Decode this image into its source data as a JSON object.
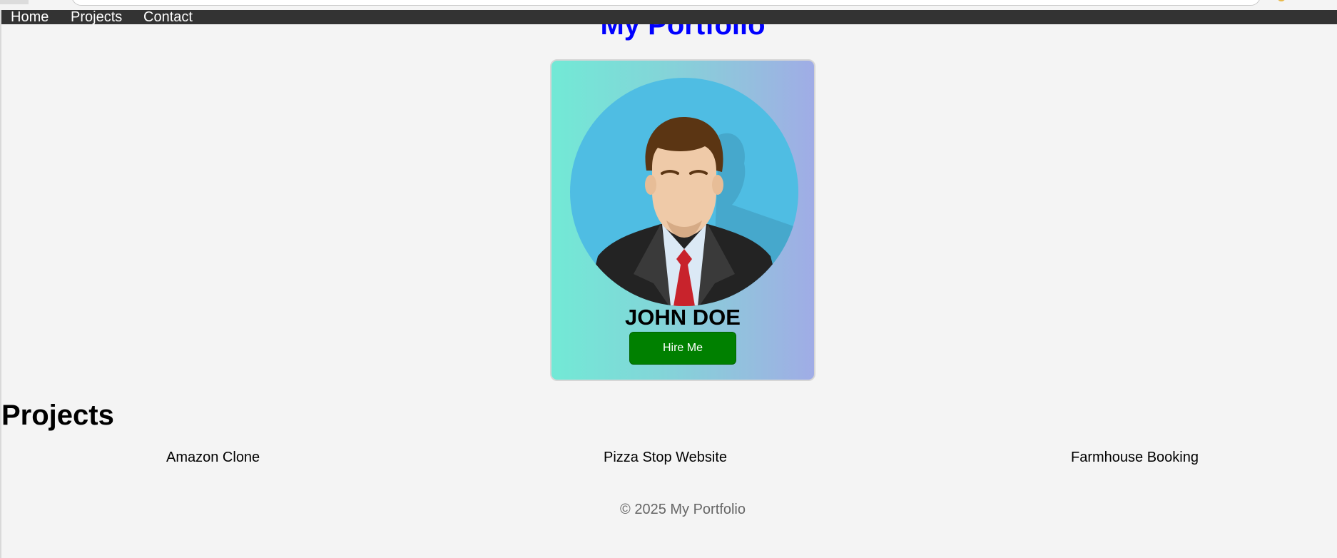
{
  "nav": {
    "items": [
      {
        "label": "Home"
      },
      {
        "label": "Projects"
      },
      {
        "label": "Contact"
      }
    ]
  },
  "header": {
    "title": "My Portfolio"
  },
  "profile": {
    "name": "JOHN DOE",
    "hire_label": "Hire Me"
  },
  "projects": {
    "heading": "Projects",
    "items": [
      {
        "label": "Amazon Clone"
      },
      {
        "label": "Pizza Stop Website"
      },
      {
        "label": "Farmhouse Booking"
      }
    ]
  },
  "footer": {
    "text": "© 2025 My Portfolio"
  },
  "colors": {
    "nav_background": "#333333",
    "heading": "#0000ff",
    "hire_button": "#008000",
    "card_gradient_start": "#72e9d6",
    "card_gradient_end": "#a0ace6",
    "avatar_background": "#4fbde3"
  }
}
